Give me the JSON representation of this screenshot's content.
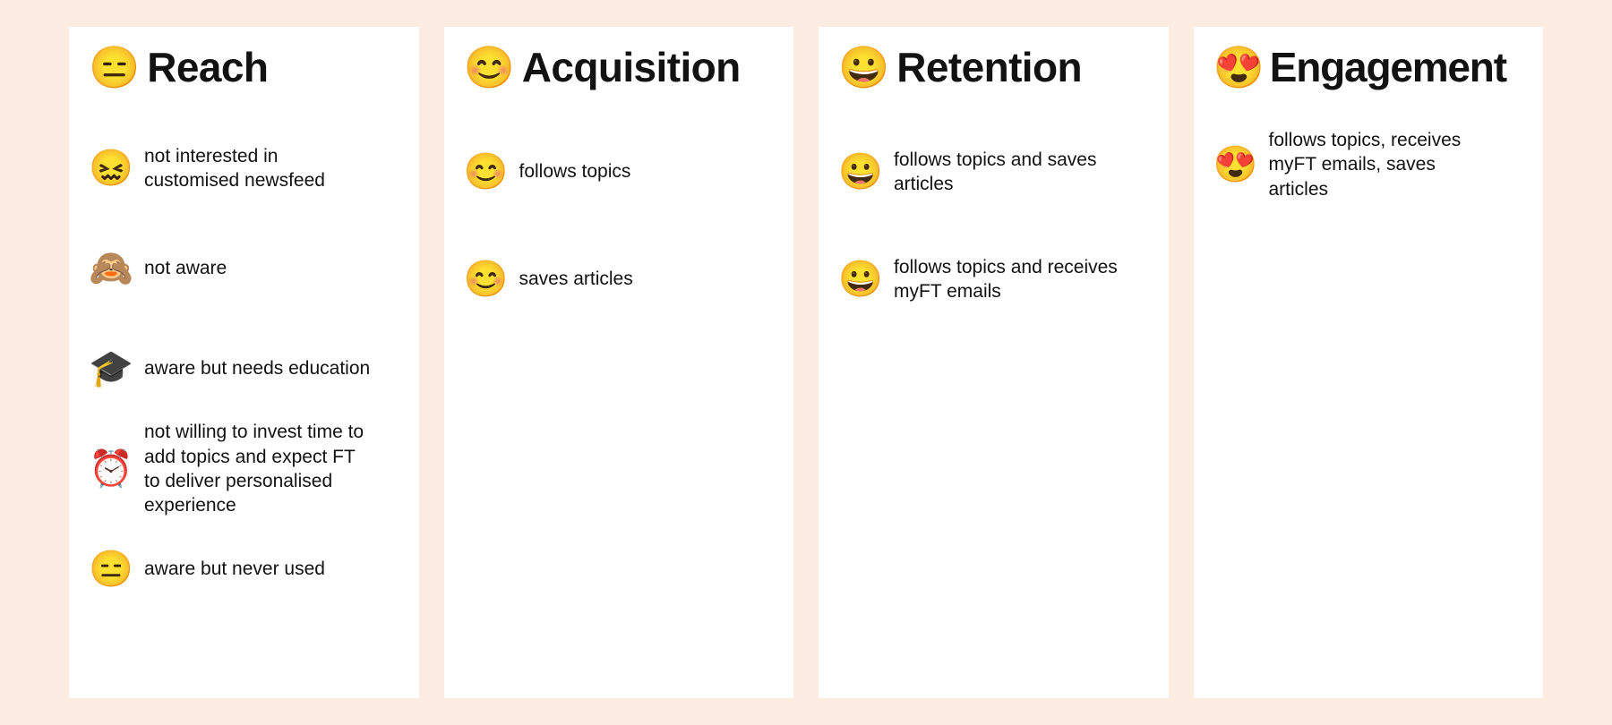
{
  "background_color": "#fdece2",
  "card_color": "#ffffff",
  "text_color": "#121212",
  "columns": [
    {
      "key": "reach",
      "header_emoji": "😑",
      "header_emoji_name": "expressionless-face-emoji",
      "title": "Reach",
      "items": [
        {
          "emoji": "😖",
          "emoji_name": "confounded-face-emoji",
          "text": "not interested in customised newsfeed"
        },
        {
          "emoji": "🙈",
          "emoji_name": "see-no-evil-monkey-emoji",
          "text": "not aware"
        },
        {
          "emoji": "🎓",
          "emoji_name": "graduation-cap-emoji",
          "text": "aware but needs education"
        },
        {
          "emoji": "⏰",
          "emoji_name": "alarm-clock-emoji",
          "text": "not willing to invest time to add topics and expect FT to deliver personalised experience"
        },
        {
          "emoji": "😑",
          "emoji_name": "expressionless-face-emoji",
          "text": "aware but never used"
        }
      ]
    },
    {
      "key": "acquisition",
      "header_emoji": "😊",
      "header_emoji_name": "smiling-face-with-smiling-eyes-emoji",
      "title": "Acquisition",
      "items": [
        {
          "emoji": "😊",
          "emoji_name": "smiling-face-with-smiling-eyes-emoji",
          "text": "follows topics"
        },
        {
          "emoji": "😊",
          "emoji_name": "smiling-face-with-smiling-eyes-emoji",
          "text": "saves articles"
        }
      ]
    },
    {
      "key": "retention",
      "header_emoji": "😀",
      "header_emoji_name": "grinning-face-emoji",
      "title": "Retention",
      "items": [
        {
          "emoji": "😀",
          "emoji_name": "grinning-face-emoji",
          "text": "follows topics and saves articles"
        },
        {
          "emoji": "😀",
          "emoji_name": "grinning-face-emoji",
          "text": "follows topics and receives myFT emails"
        }
      ]
    },
    {
      "key": "engagement",
      "header_emoji": "😍",
      "header_emoji_name": "smiling-face-with-heart-eyes-emoji",
      "title": "Engagement",
      "items": [
        {
          "emoji": "😍",
          "emoji_name": "smiling-face-with-heart-eyes-emoji",
          "text": "follows topics, receives myFT emails, saves articles"
        }
      ]
    }
  ]
}
